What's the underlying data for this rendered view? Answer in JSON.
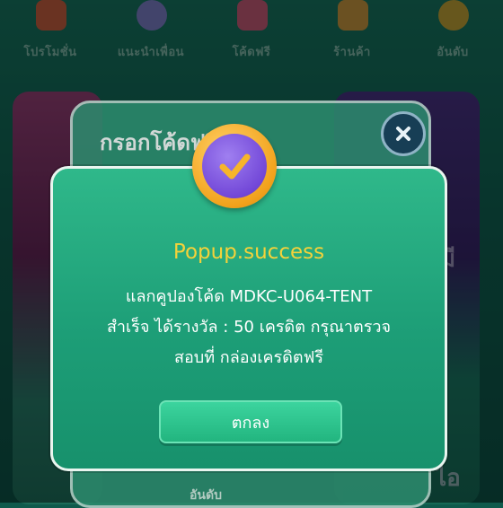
{
  "nav": {
    "items": [
      {
        "label": "โปรโมชั่น",
        "icon": "megaphone-icon",
        "color": "#e05a3a"
      },
      {
        "label": "แนะนำเพื่อน",
        "icon": "friends-icon",
        "color": "#8a7fd6"
      },
      {
        "label": "โค้ดฟรี",
        "icon": "ticket-icon",
        "color": "#e0557a"
      },
      {
        "label": "ร้านค้า",
        "icon": "shop-icon",
        "color": "#e29a3a"
      },
      {
        "label": "อันดับ",
        "icon": "medal-icon",
        "color": "#d9a72f"
      }
    ]
  },
  "background": {
    "modal_title": "กรอกโค้ดฟรี",
    "bottom_label": "อันดับ",
    "right_card_text_1": "มี",
    "right_card_text_2": "ไอ"
  },
  "popup": {
    "title": "Popup.success",
    "message_line1": "แลกคูปองโค้ด MDKC-U064-TENT",
    "message_line2": "สำเร็จ ได้รางวัล : 50 เครดิต กรุณาตรวจ",
    "message_line3": "สอบที่ กล่องเครดิตฟรี",
    "ok_label": "ตกลง",
    "badge_icon": "checkmark-icon"
  },
  "colors": {
    "popup_green": "#1d9e77",
    "title_yellow": "#f4d23a",
    "badge_gold": "#f2a21c",
    "badge_purple": "#7348d8"
  }
}
